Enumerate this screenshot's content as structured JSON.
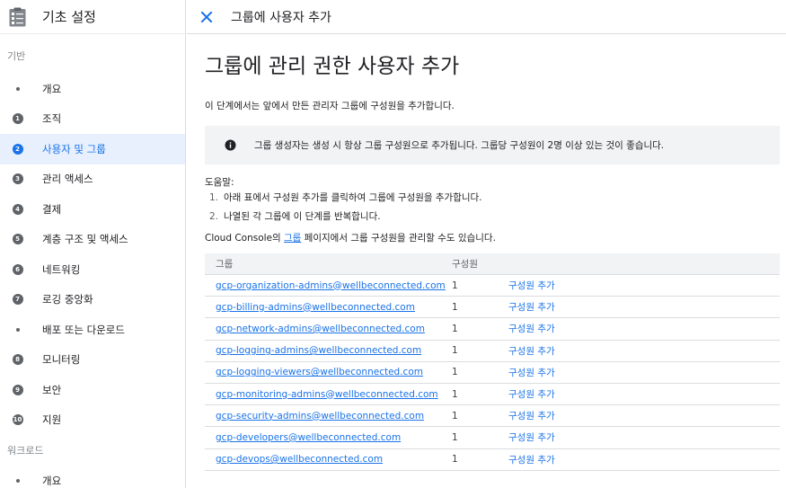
{
  "sidebar": {
    "title": "기초 설정",
    "section_base": "기반",
    "section_workload": "워크로드",
    "items": [
      {
        "marker": "",
        "label": "개요"
      },
      {
        "marker": "1",
        "label": "조직"
      },
      {
        "marker": "2",
        "label": "사용자 및 그룹",
        "active": true
      },
      {
        "marker": "3",
        "label": "관리 액세스"
      },
      {
        "marker": "4",
        "label": "결제"
      },
      {
        "marker": "5",
        "label": "계층 구조 및 액세스"
      },
      {
        "marker": "6",
        "label": "네트워킹"
      },
      {
        "marker": "7",
        "label": "로깅 중앙화"
      },
      {
        "marker": "",
        "label": "배포 또는 다운로드"
      },
      {
        "marker": "8",
        "label": "모니터링"
      },
      {
        "marker": "9",
        "label": "보안"
      },
      {
        "marker": "10",
        "label": "지원"
      }
    ],
    "workload_items": [
      {
        "marker": "",
        "label": "개요"
      }
    ]
  },
  "topbar": {
    "close_icon": "close-icon",
    "title": "그룹에 사용자 추가"
  },
  "main": {
    "heading": "그룹에 관리 권한 사용자 추가",
    "intro": "이 단계에서는 앞에서 만든 관리자 그룹에 구성원을 추가합니다.",
    "notice": "그룹 생성자는 생성 시 항상 그룹 구성원으로 추가됩니다. 그룹당 구성원이 2명 이상 있는 것이 좋습니다.",
    "help_title": "도움말:",
    "help_steps": [
      {
        "num": "1.",
        "text": "아래 표에서 구성원 추가를 클릭하여 그룹에 구성원을 추가합니다."
      },
      {
        "num": "2.",
        "text": "나열된 각 그룹에 이 단계를 반복합니다."
      }
    ],
    "console_prefix": "Cloud Console의 ",
    "console_link": "그룹",
    "console_suffix": " 페이지에서 그룹 구성원을 관리할 수도 있습니다."
  },
  "table": {
    "headers": {
      "group": "그룹",
      "members": "구성원"
    },
    "rows": [
      {
        "group": "gcp-organization-admins@wellbeconnected.com",
        "members": "1",
        "action": "구성원 추가"
      },
      {
        "group": "gcp-billing-admins@wellbeconnected.com",
        "members": "1",
        "action": "구성원 추가"
      },
      {
        "group": "gcp-network-admins@wellbeconnected.com",
        "members": "1",
        "action": "구성원 추가"
      },
      {
        "group": "gcp-logging-admins@wellbeconnected.com",
        "members": "1",
        "action": "구성원 추가"
      },
      {
        "group": "gcp-logging-viewers@wellbeconnected.com",
        "members": "1",
        "action": "구성원 추가"
      },
      {
        "group": "gcp-monitoring-admins@wellbeconnected.com",
        "members": "1",
        "action": "구성원 추가"
      },
      {
        "group": "gcp-security-admins@wellbeconnected.com",
        "members": "1",
        "action": "구성원 추가"
      },
      {
        "group": "gcp-developers@wellbeconnected.com",
        "members": "1",
        "action": "구성원 추가"
      },
      {
        "group": "gcp-devops@wellbeconnected.com",
        "members": "1",
        "action": "구성원 추가"
      }
    ]
  },
  "colors": {
    "accent": "#1a73e8",
    "active_bg": "#e8f0fe",
    "notice_bg": "#f1f3f4"
  }
}
